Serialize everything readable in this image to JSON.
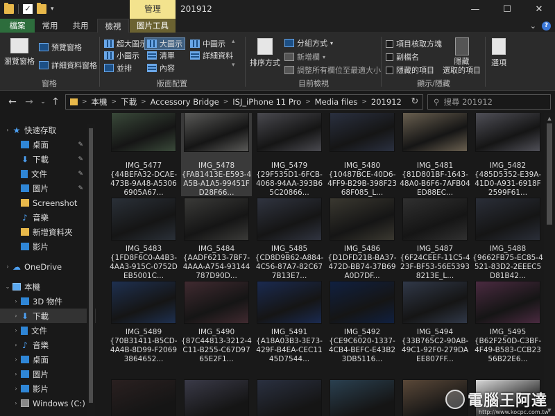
{
  "titlebar": {
    "manage_tab": "管理",
    "window_title": "201912",
    "minimize": "—",
    "maximize": "☐",
    "close": "✕"
  },
  "ribbon_tabs": {
    "file": "檔案",
    "home": "常用",
    "share": "共用",
    "view": "檢視",
    "picture_tools": "圖片工具",
    "collapse": "⌄",
    "help": "?"
  },
  "ribbon": {
    "panes": {
      "nav_pane": "瀏覽窗格",
      "preview_pane": "預覽窗格",
      "details_pane": "詳細資料窗格",
      "label": "窗格"
    },
    "layout": {
      "extra_large": "超大圖示",
      "large": "大圖示",
      "medium": "中圖示",
      "small": "小圖示",
      "list": "清單",
      "details": "詳細資料",
      "tiles": "並排",
      "content": "內容",
      "label": "版面配置"
    },
    "current_view": {
      "sort_by": "排序方式",
      "group_by": "分組方式",
      "add_columns": "新增欄",
      "size_all_columns": "調整所有欄位至最適大小",
      "label": "目前檢視"
    },
    "show_hide": {
      "item_checkboxes": "項目核取方塊",
      "file_extensions": "副檔名",
      "hidden_items": "隱藏的項目",
      "hide_selected": "隱藏\n選取的項目",
      "label": "顯示/隱藏"
    },
    "options": "選項"
  },
  "address": {
    "crumbs": [
      "本機",
      "下載",
      "Accessory Bridge",
      "ISJ_iPhone 11 Pro",
      "Media files",
      "201912"
    ],
    "search_placeholder": "搜尋 201912"
  },
  "nav": {
    "items": [
      {
        "label": "快速存取"
      },
      {
        "label": "桌面"
      },
      {
        "label": "下載"
      },
      {
        "label": "文件"
      },
      {
        "label": "圖片"
      },
      {
        "label": "Screenshot"
      },
      {
        "label": "音樂"
      },
      {
        "label": "新增資料夾"
      },
      {
        "label": "影片"
      },
      {
        "label": "OneDrive"
      },
      {
        "label": "本機"
      },
      {
        "label": "3D 物件"
      },
      {
        "label": "下載"
      },
      {
        "label": "文件"
      },
      {
        "label": "音樂"
      },
      {
        "label": "桌面"
      },
      {
        "label": "圖片"
      },
      {
        "label": "影片"
      },
      {
        "label": "Windows (C:)"
      }
    ]
  },
  "files": [
    {
      "name": "IMG_5477",
      "guid": "{44BEFA32-DCAE-473B-9A48-A53066905A67...",
      "color": "#3a4a3a"
    },
    {
      "name": "IMG_5478",
      "guid": "{FAB1413E-E593-4A5B-A1A5-99451FD28F66...",
      "color": "#5a5a58"
    },
    {
      "name": "IMG_5479",
      "guid": "{29F535D1-6FCB-4068-94AA-393B65C20866...",
      "color": "#4a4a50"
    },
    {
      "name": "IMG_5480",
      "guid": "{10487BCE-40D6-4FF9-B29B-398F2368F085_L...",
      "color": "#2a3040"
    },
    {
      "name": "IMG_5481",
      "guid": "{81D801BF-1643-48A0-B6F6-7AFB04ED88EC...",
      "color": "#6a6050"
    },
    {
      "name": "IMG_5482",
      "guid": "{485D5352-E39A-41D0-A931-6918F2599F61...",
      "color": "#505058"
    },
    {
      "name": "IMG_5483",
      "guid": "{1FD8F6C0-A4B3-4AA3-915C-0752DEB5001C...",
      "color": "#2a3038"
    },
    {
      "name": "IMG_5484",
      "guid": "{AADF6213-7BF7-4AAA-A754-93144787D90D...",
      "color": "#3a3a38"
    },
    {
      "name": "IMG_5485",
      "guid": "{CD8D9B62-A884-4C56-87A7-82C677B13E7...",
      "color": "#303440"
    },
    {
      "name": "IMG_5486",
      "guid": "{D1DFD21B-BA37-472D-BB74-37B69A0D7DF...",
      "color": "#3a3830"
    },
    {
      "name": "IMG_5487",
      "guid": "{6F24CEEF-11C5-423F-BF53-56E53938213E_L...",
      "color": "#303030"
    },
    {
      "name": "IMG_5488",
      "guid": "{9662FB75-EC85-4521-83D2-2EEEC5D81B42...",
      "color": "#2a2e38"
    },
    {
      "name": "IMG_5489",
      "guid": "{70B31411-B5CD-4A4B-8D99-F20693864652...",
      "color": "#1e3050"
    },
    {
      "name": "IMG_5490",
      "guid": "{87C44813-3212-4C11-B255-C67D9765E2F1...",
      "color": "#402a30"
    },
    {
      "name": "IMG_5491",
      "guid": "{A18A03B3-3E73-429F-B4EA-CEC1145D7544...",
      "color": "#1a2a50"
    },
    {
      "name": "IMG_5492",
      "guid": "{CE9C6020-1337-4CB4-BEFC-E43B23DB5116...",
      "color": "#102040"
    },
    {
      "name": "IMG_5494",
      "guid": "{33B765C2-90AB-49C1-92F0-279DAEE807FF...",
      "color": "#303848"
    },
    {
      "name": "IMG_5495",
      "guid": "{B62F250D-C3BF-4F49-B583-CCB2356B22E6...",
      "color": "#4a2a40"
    }
  ],
  "watermark": {
    "text": "電腦王阿達",
    "url": "http://www.kocpc.com.tw"
  }
}
